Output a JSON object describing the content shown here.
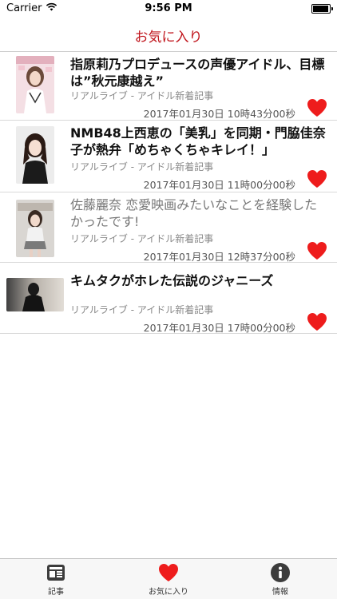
{
  "status_bar": {
    "carrier": "Carrier",
    "time": "9:56 PM",
    "wifi_icon": "wifi-icon",
    "battery_icon": "battery-icon"
  },
  "nav": {
    "title": "お気に入り"
  },
  "articles": [
    {
      "title": "指原莉乃プロデュースの声優アイドル、目標は”秋元康越え”",
      "source": "リアルライブ - アイドル新着記事",
      "date": "2017年01月30日 10時43分00秒",
      "read": false,
      "favorite_icon": "heart-icon"
    },
    {
      "title": "NMB48上西恵の「美乳」を同期・門脇佳奈子が熱弁「めちゃくちゃキレイ！」",
      "source": "リアルライブ - アイドル新着記事",
      "date": "2017年01月30日 11時00分00秒",
      "read": false,
      "favorite_icon": "heart-icon"
    },
    {
      "title": "佐藤麗奈 恋愛映画みたいなことを経験したかったです!",
      "source": "リアルライブ - アイドル新着記事",
      "date": "2017年01月30日 12時37分00秒",
      "read": true,
      "favorite_icon": "heart-icon"
    },
    {
      "title": "キムタクがホレた伝説のジャニーズ",
      "source": "リアルライブ - アイドル新着記事",
      "date": "2017年01月30日 17時00分00秒",
      "read": false,
      "favorite_icon": "heart-icon"
    }
  ],
  "tabs": [
    {
      "label": "記事",
      "icon": "newspaper-icon",
      "selected": false
    },
    {
      "label": "お気に入り",
      "icon": "heart-icon",
      "selected": true
    },
    {
      "label": "情報",
      "icon": "info-icon",
      "selected": false
    }
  ],
  "colors": {
    "accent": "#c0151c",
    "heart": "#ee1c1c",
    "unread_title": "#111111",
    "read_title": "#777777",
    "meta_text": "#888888"
  }
}
